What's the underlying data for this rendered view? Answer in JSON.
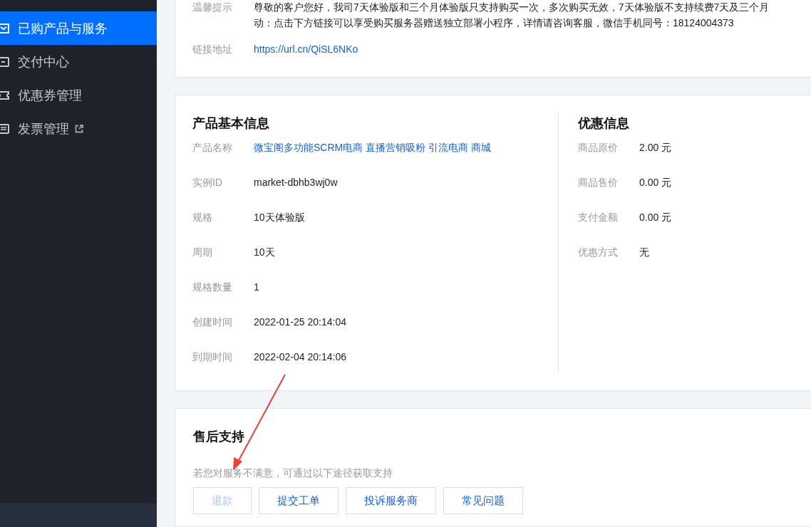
{
  "sidebar": {
    "items": [
      {
        "label": "已购产品与服务",
        "selected": true,
        "external": false
      },
      {
        "label": "交付中心",
        "selected": false,
        "external": false
      },
      {
        "label": "优惠券管理",
        "selected": false,
        "external": false
      },
      {
        "label": "发票管理",
        "selected": false,
        "external": true
      }
    ]
  },
  "notice": {
    "rows": [
      {
        "label": "温馨提示",
        "kind": "text",
        "lines": [
          "尊敬的客户您好，我司7天体验版和三个月体验版只支持购买一次，多次购买无效，7天体验版不支持续费7天及三个月",
          "动：点击下方链接可以享受购买服务器赠送独立部署小程序，详情请咨询客服，微信手机同号：18124004373"
        ]
      },
      {
        "label": "链接地址",
        "kind": "link",
        "lines": [
          "https://url.cn/QiSL6NKo"
        ]
      }
    ]
  },
  "product": {
    "title": "产品基本信息",
    "rows": [
      {
        "label": "产品名称",
        "value": "微宝阁多功能SCRM电商 直播营销吸粉 引流电商 商城",
        "kind": "link"
      },
      {
        "label": "实例ID",
        "value": "market-dbhb3wj0w",
        "kind": "text"
      },
      {
        "label": "规格",
        "value": "10天体验版",
        "kind": "text"
      },
      {
        "label": "周期",
        "value": "10天",
        "kind": "text"
      },
      {
        "label": "规格数量",
        "value": "1",
        "kind": "text"
      },
      {
        "label": "创建时间",
        "value": "2022-01-25 20:14:04",
        "kind": "text"
      },
      {
        "label": "到期时间",
        "value": "2022-02-04 20:14:06",
        "kind": "text"
      }
    ]
  },
  "discount": {
    "title": "优惠信息",
    "rows": [
      {
        "label": "商品原价",
        "value": "2.00 元"
      },
      {
        "label": "商品售价",
        "value": "0.00 元"
      },
      {
        "label": "支付金额",
        "value": "0.00 元"
      },
      {
        "label": "优惠方式",
        "value": "无"
      }
    ]
  },
  "support": {
    "title": "售后支持",
    "hint": "若您对服务不满意，可通过以下途径获取支持",
    "buttons": [
      {
        "label": "退款",
        "disabled": true
      },
      {
        "label": "提交工单",
        "disabled": false
      },
      {
        "label": "投诉服务商",
        "disabled": false
      },
      {
        "label": "常见问题",
        "disabled": false
      }
    ]
  }
}
